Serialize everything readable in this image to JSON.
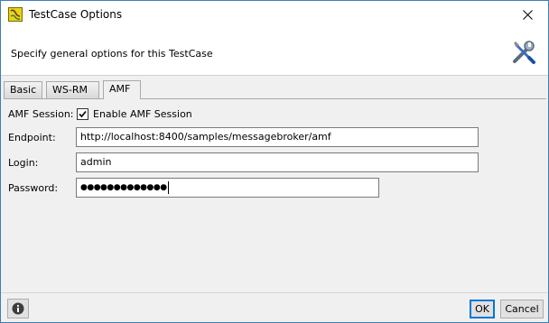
{
  "window": {
    "title": "TestCase Options",
    "close_label": "×"
  },
  "header": {
    "description": "Specify general options for this TestCase"
  },
  "tabs": [
    {
      "label": "Basic",
      "active": false
    },
    {
      "label": "WS-RM",
      "active": false
    },
    {
      "label": "AMF",
      "active": true
    }
  ],
  "amf": {
    "session_label": "AMF Session:",
    "enable_label": "Enable AMF Session",
    "enable_checked": true,
    "endpoint_label": "Endpoint:",
    "endpoint_value": "http://localhost:8400/samples/messagebroker/amf",
    "login_label": "Login:",
    "login_value": "admin",
    "password_label": "Password:",
    "password_masked": "●●●●●●●●●●●●●"
  },
  "footer": {
    "ok_label": "OK",
    "cancel_label": "Cancel",
    "info_icon": "info-icon"
  },
  "colors": {
    "focus_border": "#0078d7",
    "window_border": "#3c7fb1"
  }
}
